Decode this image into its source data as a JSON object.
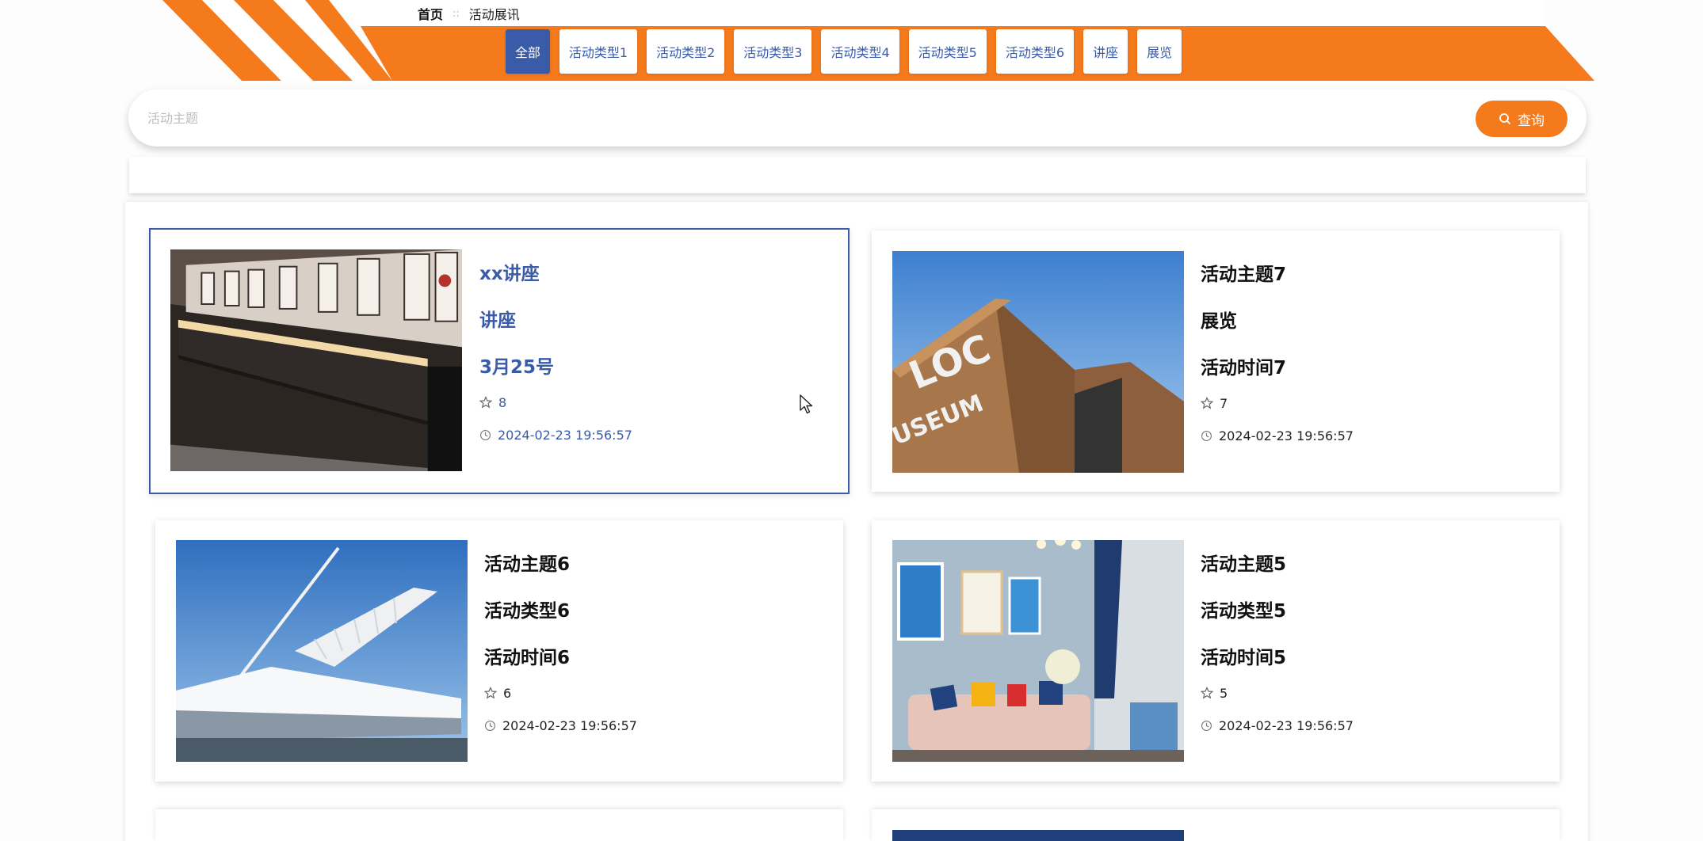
{
  "breadcrumb": {
    "home": "首页",
    "separator": "::",
    "current": "活动展讯"
  },
  "tabs": [
    {
      "label": "全部",
      "active": true
    },
    {
      "label": "活动类型1",
      "active": false
    },
    {
      "label": "活动类型2",
      "active": false
    },
    {
      "label": "活动类型3",
      "active": false
    },
    {
      "label": "活动类型4",
      "active": false
    },
    {
      "label": "活动类型5",
      "active": false
    },
    {
      "label": "活动类型6",
      "active": false
    },
    {
      "label": "讲座",
      "active": false
    },
    {
      "label": "展览",
      "active": false
    }
  ],
  "search": {
    "placeholder": "活动主题",
    "value": "",
    "button_label": "查询",
    "icon": "search-icon"
  },
  "cards": [
    {
      "title": "xx讲座",
      "type": "讲座",
      "time": "3月25号",
      "likes": "8",
      "created": "2024-02-23 19:56:57",
      "image": "exhibition-hall-photo",
      "selected": true
    },
    {
      "title": "活动主题7",
      "type": "展览",
      "time": "活动时间7",
      "likes": "7",
      "created": "2024-02-23 19:56:57",
      "image": "museum-building-photo",
      "selected": false
    },
    {
      "title": "活动主题6",
      "type": "活动类型6",
      "time": "活动时间6",
      "likes": "6",
      "created": "2024-02-23 19:56:57",
      "image": "white-architecture-photo",
      "selected": false
    },
    {
      "title": "活动主题5",
      "type": "活动类型5",
      "time": "活动时间5",
      "likes": "5",
      "created": "2024-02-23 19:56:57",
      "image": "living-room-photo",
      "selected": false
    }
  ],
  "colors": {
    "accent_orange": "#f57a1c",
    "accent_blue": "#3a5ba8"
  }
}
